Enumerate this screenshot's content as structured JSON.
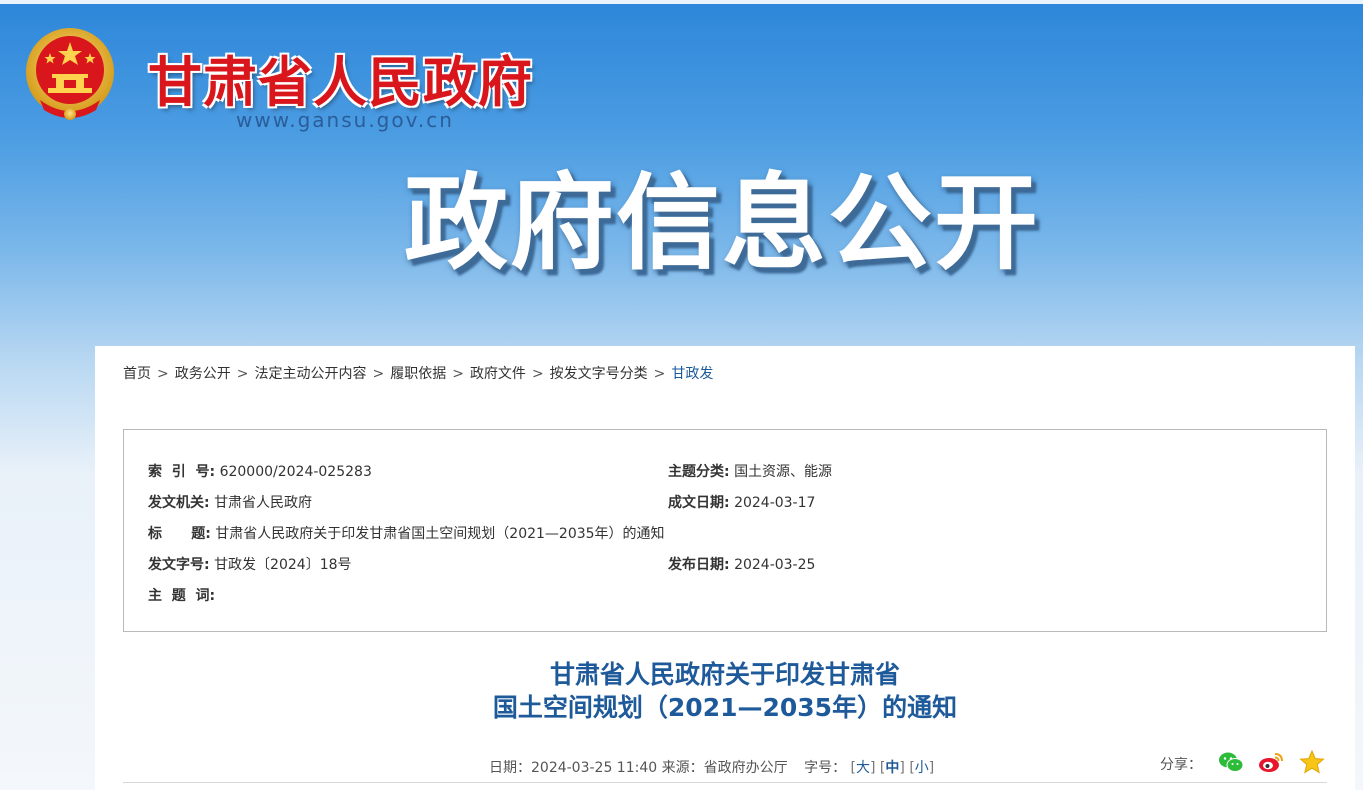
{
  "header": {
    "site_name": "甘肃省人民政府",
    "site_url": "www.gansu.gov.cn",
    "section_title": "政府信息公开"
  },
  "breadcrumb": [
    "首页",
    "政务公开",
    "法定主动公开内容",
    "履职依据",
    "政府文件",
    "按发文字号分类",
    "甘政发"
  ],
  "breadcrumb_sep": ">",
  "info": {
    "index_no_label": "索  引  号:",
    "index_no": "620000/2024-025283",
    "topic_label": "主题分类:",
    "topic": "国土资源、能源",
    "issuer_label": "发文机关:",
    "issuer": "甘肃省人民政府",
    "created_label": "成文日期:",
    "created": "2024-03-17",
    "title_label": "标      题:",
    "title": "甘肃省人民政府关于印发甘肃省国土空间规划（2021—2035年）的通知",
    "doc_no_label": "发文字号:",
    "doc_no": "甘政发〔2024〕18号",
    "published_label": "发布日期:",
    "published": "2024-03-25",
    "keywords_label": "主  题  词:",
    "keywords": ""
  },
  "article": {
    "title_line1": "甘肃省人民政府关于印发甘肃省",
    "title_line2": "国土空间规划（2021—2035年）的通知",
    "meta_date": "日期：2024-03-25 11:40",
    "meta_source": "来源：省政府办公厅",
    "font_size_label": "字号：",
    "size_large": "大",
    "size_medium": "中",
    "size_small": "小",
    "share_label": "分享："
  },
  "colors": {
    "brand_red": "#d8161b",
    "link_blue": "#1e5a9a",
    "banner_blue": "#2d86d9"
  },
  "icons": [
    "national-emblem-icon",
    "wechat-icon",
    "weibo-icon",
    "favorite-star-icon"
  ]
}
